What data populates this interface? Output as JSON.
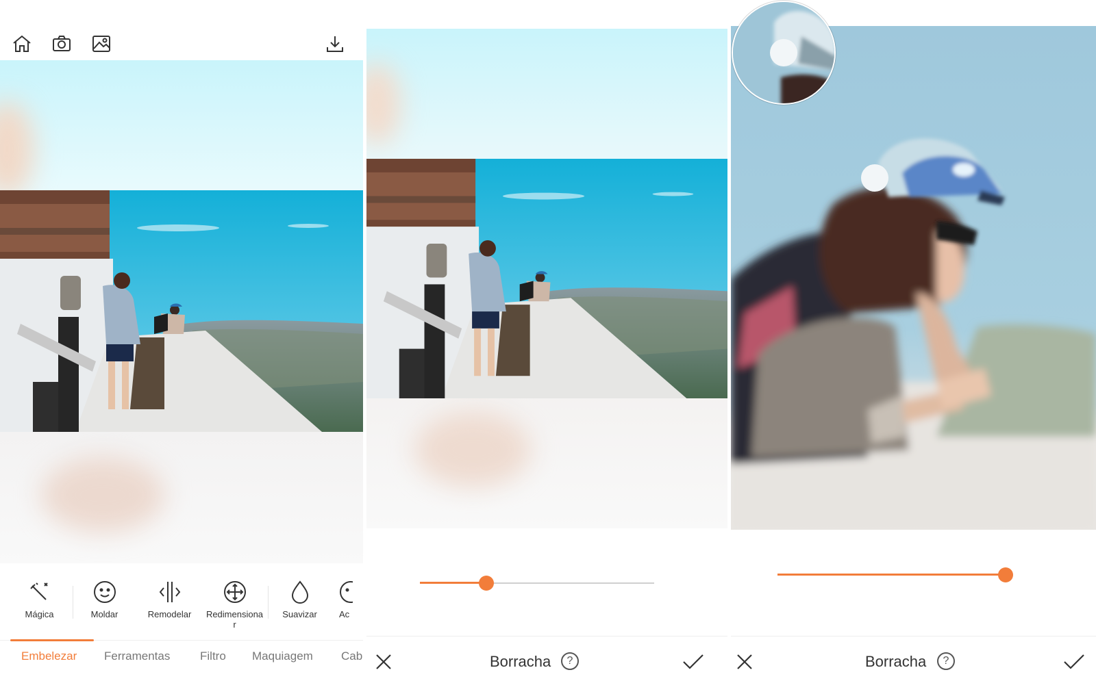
{
  "left_screen": {
    "toolbar": {
      "home_icon": "home-icon",
      "camera_icon": "camera-icon",
      "gallery_icon": "gallery-icon",
      "download_icon": "download-icon"
    },
    "tools": [
      {
        "label": "Mágica",
        "icon": "magic-wand-icon"
      },
      {
        "label": "Moldar",
        "icon": "face-icon"
      },
      {
        "label": "Remodelar",
        "icon": "reshape-icon"
      },
      {
        "label": "Redimensionar",
        "icon": "resize-icon"
      },
      {
        "label": "Suavizar",
        "icon": "drop-icon"
      },
      {
        "label": "Ac",
        "icon": "partial-icon"
      }
    ],
    "tabs": [
      "Embelezar",
      "Ferramentas",
      "Filtro",
      "Maquiagem",
      "Cab"
    ],
    "active_tab": "Embelezar"
  },
  "middle_screen": {
    "slider_value": 0.27,
    "title": "Borracha",
    "help_symbol": "?"
  },
  "right_screen": {
    "slider_value": 1.0,
    "title": "Borracha",
    "help_symbol": "?"
  },
  "colors": {
    "accent": "#f27d3a",
    "sky": "#c9f4fb",
    "text": "#333333"
  }
}
